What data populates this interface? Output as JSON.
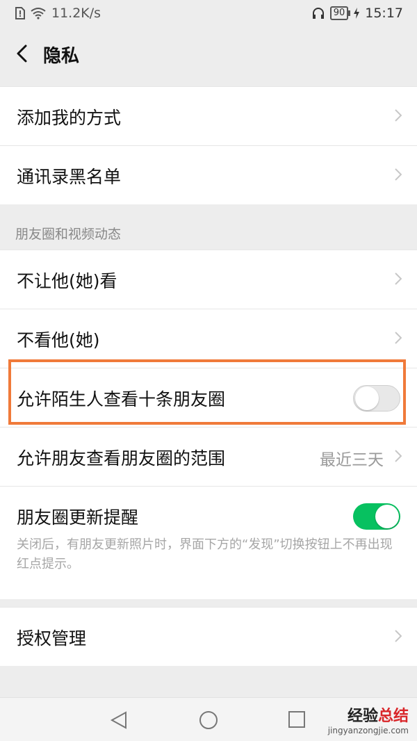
{
  "status_bar": {
    "network_speed": "11.2K/s",
    "battery": "90",
    "time": "15:17"
  },
  "nav": {
    "title": "隐私"
  },
  "top_group": [
    {
      "label": "添加我的方式"
    },
    {
      "label": "通讯录黑名单"
    }
  ],
  "moments_section": {
    "title": "朋友圈和视频动态",
    "items": {
      "hide_from": "不让他(她)看",
      "not_see": "不看他(她)",
      "stranger_ten": "允许陌生人查看十条朋友圈",
      "stranger_ten_toggle": false,
      "range_label": "允许朋友查看朋友圈的范围",
      "range_value": "最近三天",
      "update_reminder": "朋友圈更新提醒",
      "update_reminder_toggle": true,
      "update_reminder_desc": "关闭后，有朋友更新照片时，界面下方的“发现”切换按钮上不再出现红点提示。"
    }
  },
  "auth": {
    "label": "授权管理"
  },
  "watermark": {
    "brand_a": "经验",
    "brand_b": "总结",
    "url": "jingyanzongjie.com"
  },
  "colors": {
    "accent_green": "#07c160",
    "highlight_orange": "#f07a3a",
    "background": "#ededed"
  }
}
